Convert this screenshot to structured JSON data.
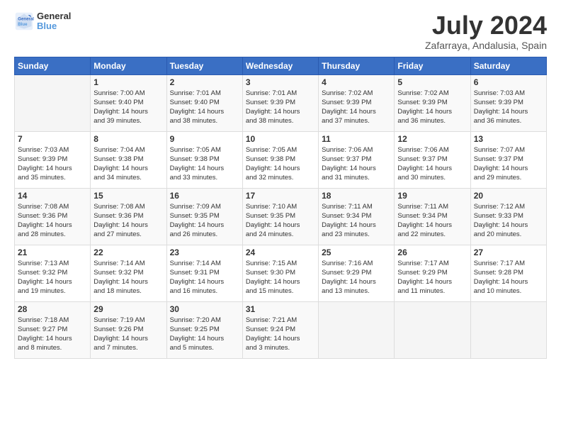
{
  "header": {
    "logo_line1": "General",
    "logo_line2": "Blue",
    "month": "July 2024",
    "location": "Zafarraya, Andalusia, Spain"
  },
  "days_of_week": [
    "Sunday",
    "Monday",
    "Tuesday",
    "Wednesday",
    "Thursday",
    "Friday",
    "Saturday"
  ],
  "weeks": [
    [
      {
        "day": "",
        "info": ""
      },
      {
        "day": "1",
        "info": "Sunrise: 7:00 AM\nSunset: 9:40 PM\nDaylight: 14 hours\nand 39 minutes."
      },
      {
        "day": "2",
        "info": "Sunrise: 7:01 AM\nSunset: 9:40 PM\nDaylight: 14 hours\nand 38 minutes."
      },
      {
        "day": "3",
        "info": "Sunrise: 7:01 AM\nSunset: 9:39 PM\nDaylight: 14 hours\nand 38 minutes."
      },
      {
        "day": "4",
        "info": "Sunrise: 7:02 AM\nSunset: 9:39 PM\nDaylight: 14 hours\nand 37 minutes."
      },
      {
        "day": "5",
        "info": "Sunrise: 7:02 AM\nSunset: 9:39 PM\nDaylight: 14 hours\nand 36 minutes."
      },
      {
        "day": "6",
        "info": "Sunrise: 7:03 AM\nSunset: 9:39 PM\nDaylight: 14 hours\nand 36 minutes."
      }
    ],
    [
      {
        "day": "7",
        "info": "Sunrise: 7:03 AM\nSunset: 9:39 PM\nDaylight: 14 hours\nand 35 minutes."
      },
      {
        "day": "8",
        "info": "Sunrise: 7:04 AM\nSunset: 9:38 PM\nDaylight: 14 hours\nand 34 minutes."
      },
      {
        "day": "9",
        "info": "Sunrise: 7:05 AM\nSunset: 9:38 PM\nDaylight: 14 hours\nand 33 minutes."
      },
      {
        "day": "10",
        "info": "Sunrise: 7:05 AM\nSunset: 9:38 PM\nDaylight: 14 hours\nand 32 minutes."
      },
      {
        "day": "11",
        "info": "Sunrise: 7:06 AM\nSunset: 9:37 PM\nDaylight: 14 hours\nand 31 minutes."
      },
      {
        "day": "12",
        "info": "Sunrise: 7:06 AM\nSunset: 9:37 PM\nDaylight: 14 hours\nand 30 minutes."
      },
      {
        "day": "13",
        "info": "Sunrise: 7:07 AM\nSunset: 9:37 PM\nDaylight: 14 hours\nand 29 minutes."
      }
    ],
    [
      {
        "day": "14",
        "info": "Sunrise: 7:08 AM\nSunset: 9:36 PM\nDaylight: 14 hours\nand 28 minutes."
      },
      {
        "day": "15",
        "info": "Sunrise: 7:08 AM\nSunset: 9:36 PM\nDaylight: 14 hours\nand 27 minutes."
      },
      {
        "day": "16",
        "info": "Sunrise: 7:09 AM\nSunset: 9:35 PM\nDaylight: 14 hours\nand 26 minutes."
      },
      {
        "day": "17",
        "info": "Sunrise: 7:10 AM\nSunset: 9:35 PM\nDaylight: 14 hours\nand 24 minutes."
      },
      {
        "day": "18",
        "info": "Sunrise: 7:11 AM\nSunset: 9:34 PM\nDaylight: 14 hours\nand 23 minutes."
      },
      {
        "day": "19",
        "info": "Sunrise: 7:11 AM\nSunset: 9:34 PM\nDaylight: 14 hours\nand 22 minutes."
      },
      {
        "day": "20",
        "info": "Sunrise: 7:12 AM\nSunset: 9:33 PM\nDaylight: 14 hours\nand 20 minutes."
      }
    ],
    [
      {
        "day": "21",
        "info": "Sunrise: 7:13 AM\nSunset: 9:32 PM\nDaylight: 14 hours\nand 19 minutes."
      },
      {
        "day": "22",
        "info": "Sunrise: 7:14 AM\nSunset: 9:32 PM\nDaylight: 14 hours\nand 18 minutes."
      },
      {
        "day": "23",
        "info": "Sunrise: 7:14 AM\nSunset: 9:31 PM\nDaylight: 14 hours\nand 16 minutes."
      },
      {
        "day": "24",
        "info": "Sunrise: 7:15 AM\nSunset: 9:30 PM\nDaylight: 14 hours\nand 15 minutes."
      },
      {
        "day": "25",
        "info": "Sunrise: 7:16 AM\nSunset: 9:29 PM\nDaylight: 14 hours\nand 13 minutes."
      },
      {
        "day": "26",
        "info": "Sunrise: 7:17 AM\nSunset: 9:29 PM\nDaylight: 14 hours\nand 11 minutes."
      },
      {
        "day": "27",
        "info": "Sunrise: 7:17 AM\nSunset: 9:28 PM\nDaylight: 14 hours\nand 10 minutes."
      }
    ],
    [
      {
        "day": "28",
        "info": "Sunrise: 7:18 AM\nSunset: 9:27 PM\nDaylight: 14 hours\nand 8 minutes."
      },
      {
        "day": "29",
        "info": "Sunrise: 7:19 AM\nSunset: 9:26 PM\nDaylight: 14 hours\nand 7 minutes."
      },
      {
        "day": "30",
        "info": "Sunrise: 7:20 AM\nSunset: 9:25 PM\nDaylight: 14 hours\nand 5 minutes."
      },
      {
        "day": "31",
        "info": "Sunrise: 7:21 AM\nSunset: 9:24 PM\nDaylight: 14 hours\nand 3 minutes."
      },
      {
        "day": "",
        "info": ""
      },
      {
        "day": "",
        "info": ""
      },
      {
        "day": "",
        "info": ""
      }
    ]
  ]
}
